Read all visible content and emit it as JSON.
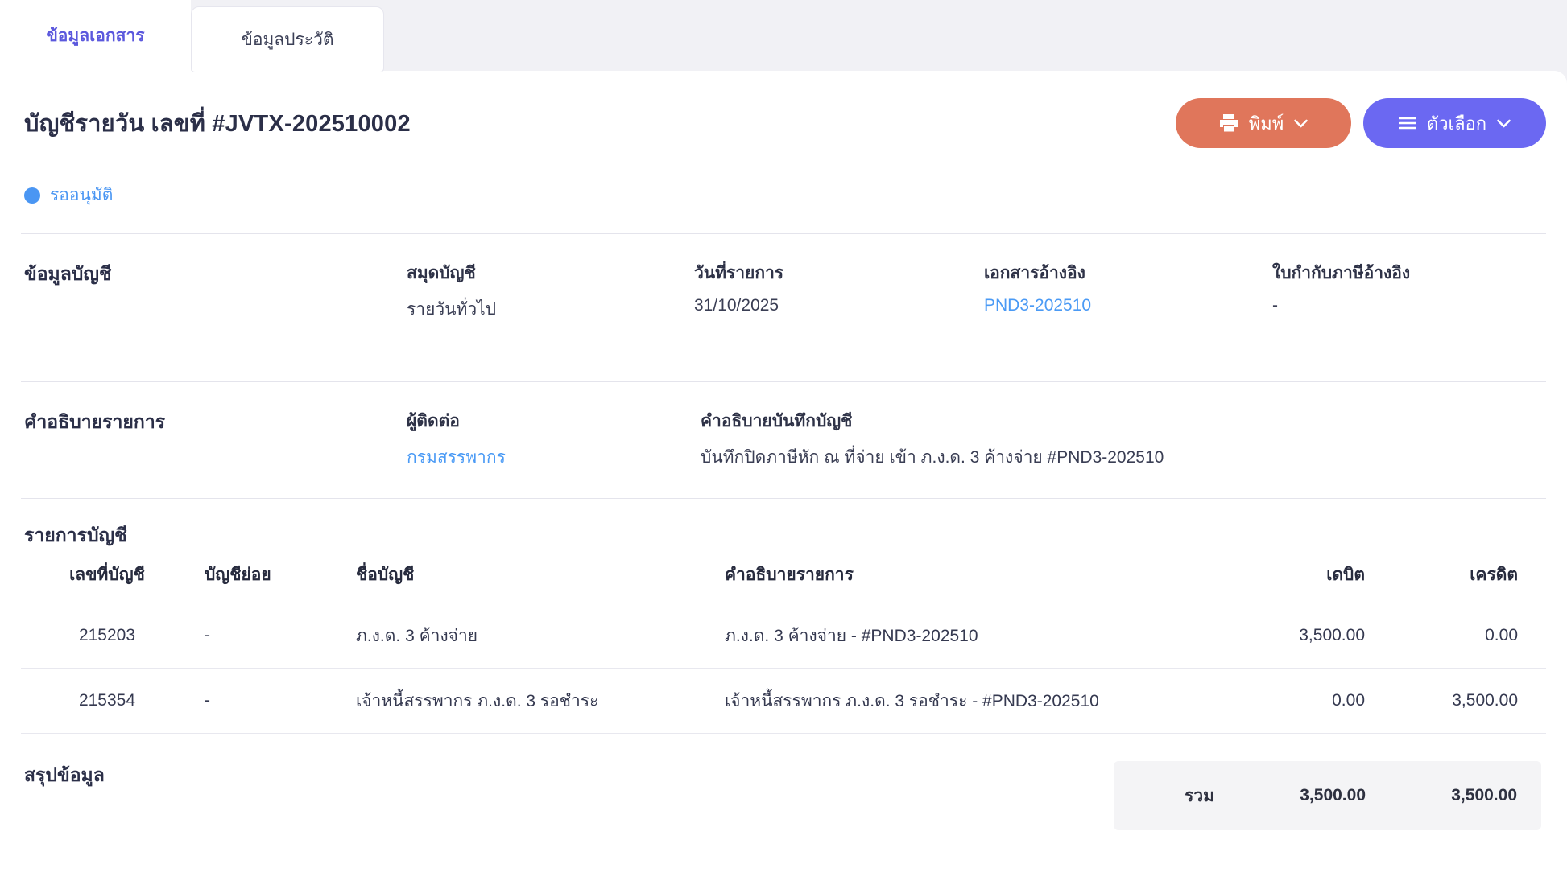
{
  "tabs": [
    {
      "label": "ข้อมูลเอกสาร",
      "active": true
    },
    {
      "label": "ข้อมูลประวัติ",
      "active": false
    }
  ],
  "header": {
    "title": "บัญชีรายวัน เลขที่ #JVTX-202510002",
    "print_label": "พิมพ์",
    "options_label": "ตัวเลือก"
  },
  "status": {
    "label": "รออนุมัติ",
    "color": "#4a96f3"
  },
  "account_info": {
    "title": "ข้อมูลบัญชี",
    "fields": [
      {
        "label": "สมุดบัญชี",
        "value": "รายวันทั่วไป"
      },
      {
        "label": "วันที่รายการ",
        "value": "31/10/2025"
      },
      {
        "label": "เอกสารอ้างอิง",
        "value": "PND3-202510"
      },
      {
        "label": "ใบกำกับภาษีอ้างอิง",
        "value": "-"
      }
    ]
  },
  "description": {
    "title": "คำอธิบายรายการ",
    "contact_label": "ผู้ติดต่อ",
    "contact_value": "กรมสรรพากร",
    "note_label": "คำอธิบายบันทึกบัญชี",
    "note_value": "บันทึกปิดภาษีหัก ณ ที่จ่าย เข้า ภ.ง.ด. 3 ค้างจ่าย #PND3-202510"
  },
  "entries": {
    "title": "รายการบัญชี",
    "columns": [
      "เลขที่บัญชี",
      "บัญชีย่อย",
      "ชื่อบัญชี",
      "คำอธิบายรายการ",
      "เดบิต",
      "เครดิต"
    ],
    "rows": [
      [
        "215203",
        "-",
        "ภ.ง.ด. 3 ค้างจ่าย",
        "ภ.ง.ด. 3 ค้างจ่าย - #PND3-202510",
        "3,500.00",
        "0.00"
      ],
      [
        "215354",
        "-",
        "เจ้าหนี้สรรพากร ภ.ง.ด. 3 รอชำระ",
        "เจ้าหนี้สรรพากร ภ.ง.ด. 3 รอชำระ - #PND3-202510",
        "0.00",
        "3,500.00"
      ]
    ]
  },
  "summary": {
    "title": "สรุปข้อมูล",
    "total_label": "รวม",
    "total_debit": "3,500.00",
    "total_credit": "3,500.00"
  },
  "colors": {
    "accent_indigo": "#5b58dd",
    "button_orange": "#e0765b",
    "button_purple": "#6b68f2",
    "status_blue": "#4a96f3",
    "link_blue": "#4a9af5",
    "topbar_gray": "#f1f1f5",
    "summary_gray": "#f4f4f6",
    "divider": "#e4e4ec"
  }
}
